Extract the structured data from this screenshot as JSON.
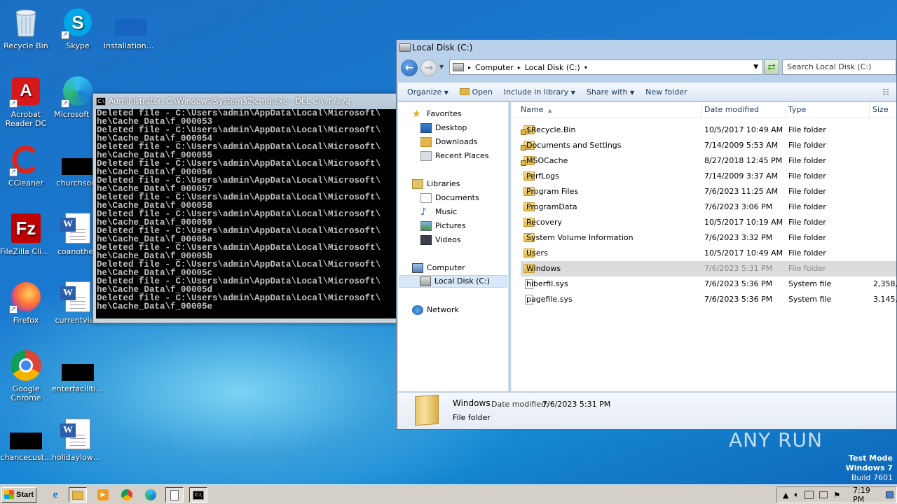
{
  "desktop": {
    "icons": [
      {
        "label": "Recycle Bin",
        "icon": "recycle-bin-icon"
      },
      {
        "label": "Skype",
        "icon": "skype-icon"
      },
      {
        "label": "installationfi...",
        "icon": "redacted-file-icon"
      },
      {
        "label": "Acrobat Reader DC",
        "icon": "acrobat-icon"
      },
      {
        "label": "Microsoft Ed",
        "icon": "edge-icon"
      },
      {
        "label": "CCleaner",
        "icon": "ccleaner-icon"
      },
      {
        "label": "churchsout",
        "icon": "redacted-file-icon"
      },
      {
        "label": "FileZilla Client",
        "icon": "filezilla-icon"
      },
      {
        "label": "coanother.",
        "icon": "word-doc-icon"
      },
      {
        "label": "Firefox",
        "icon": "firefox-icon"
      },
      {
        "label": "currentview",
        "icon": "word-doc-icon"
      },
      {
        "label": "Google Chrome",
        "icon": "chrome-icon"
      },
      {
        "label": "enterfacilitie...",
        "icon": "redacted-file-icon"
      },
      {
        "label": "chancecust...",
        "icon": "redacted-file-icon"
      },
      {
        "label": "holidaylowe...",
        "icon": "word-doc-icon"
      }
    ]
  },
  "cmd": {
    "title": "Administrator: C:\\Windows\\System32\\cmd.exe - DEL  C:\\ /f /s /q",
    "lines": [
      "Deleted file - C:\\Users\\admin\\AppData\\Local\\Microsoft\\",
      "he\\Cache_Data\\f_000053",
      "Deleted file - C:\\Users\\admin\\AppData\\Local\\Microsoft\\",
      "he\\Cache_Data\\f_000054",
      "Deleted file - C:\\Users\\admin\\AppData\\Local\\Microsoft\\",
      "he\\Cache_Data\\f_000055",
      "Deleted file - C:\\Users\\admin\\AppData\\Local\\Microsoft\\",
      "he\\Cache_Data\\f_000056",
      "Deleted file - C:\\Users\\admin\\AppData\\Local\\Microsoft\\",
      "he\\Cache_Data\\f_000057",
      "Deleted file - C:\\Users\\admin\\AppData\\Local\\Microsoft\\",
      "he\\Cache_Data\\f_000058",
      "Deleted file - C:\\Users\\admin\\AppData\\Local\\Microsoft\\",
      "he\\Cache_Data\\f_000059",
      "Deleted file - C:\\Users\\admin\\AppData\\Local\\Microsoft\\",
      "he\\Cache_Data\\f_00005a",
      "Deleted file - C:\\Users\\admin\\AppData\\Local\\Microsoft\\",
      "he\\Cache_Data\\f_00005b",
      "Deleted file - C:\\Users\\admin\\AppData\\Local\\Microsoft\\",
      "he\\Cache_Data\\f_00005c",
      "Deleted file - C:\\Users\\admin\\AppData\\Local\\Microsoft\\",
      "he\\Cache_Data\\f_00005d",
      "Deleted file - C:\\Users\\admin\\AppData\\Local\\Microsoft\\",
      "he\\Cache_Data\\f_00005e"
    ]
  },
  "explorer": {
    "title": "Local Disk (C:)",
    "breadcrumb": [
      "Computer",
      "Local Disk (C:)"
    ],
    "search_placeholder": "Search Local Disk (C:)",
    "toolbar": {
      "organize": "Organize",
      "open": "Open",
      "include": "Include in library",
      "share": "Share with",
      "new_folder": "New folder"
    },
    "nav": {
      "favorites": "Favorites",
      "desktop": "Desktop",
      "downloads": "Downloads",
      "recent": "Recent Places",
      "libraries": "Libraries",
      "documents": "Documents",
      "music": "Music",
      "pictures": "Pictures",
      "videos": "Videos",
      "computer": "Computer",
      "local_disk": "Local Disk (C:)",
      "network": "Network"
    },
    "columns": {
      "name": "Name",
      "date": "Date modified",
      "type": "Type",
      "size": "Size"
    },
    "files": [
      {
        "name": "$Recycle.Bin",
        "date": "10/5/2017 10:49 AM",
        "type": "File folder",
        "size": "",
        "kind": "locked-folder"
      },
      {
        "name": "Documents and Settings",
        "date": "7/14/2009 5:53 AM",
        "type": "File folder",
        "size": "",
        "kind": "locked-folder"
      },
      {
        "name": "MSOCache",
        "date": "8/27/2018 12:45 PM",
        "type": "File folder",
        "size": "",
        "kind": "locked-folder"
      },
      {
        "name": "PerfLogs",
        "date": "7/14/2009 3:37 AM",
        "type": "File folder",
        "size": "",
        "kind": "folder"
      },
      {
        "name": "Program Files",
        "date": "7/6/2023 11:25 AM",
        "type": "File folder",
        "size": "",
        "kind": "folder"
      },
      {
        "name": "ProgramData",
        "date": "7/6/2023 3:06 PM",
        "type": "File folder",
        "size": "",
        "kind": "folder"
      },
      {
        "name": "Recovery",
        "date": "10/5/2017 10:19 AM",
        "type": "File folder",
        "size": "",
        "kind": "folder"
      },
      {
        "name": "System Volume Information",
        "date": "7/6/2023 3:32 PM",
        "type": "File folder",
        "size": "",
        "kind": "folder"
      },
      {
        "name": "Users",
        "date": "10/5/2017 10:49 AM",
        "type": "File folder",
        "size": "",
        "kind": "folder"
      },
      {
        "name": "Windows",
        "date": "7/6/2023 5:31 PM",
        "type": "File folder",
        "size": "",
        "kind": "folder",
        "selected": true
      },
      {
        "name": "hiberfil.sys",
        "date": "7/6/2023 5:36 PM",
        "type": "System file",
        "size": "2,358,",
        "kind": "sysfile"
      },
      {
        "name": "pagefile.sys",
        "date": "7/6/2023 5:36 PM",
        "type": "System file",
        "size": "3,145,",
        "kind": "sysfile"
      }
    ],
    "details": {
      "name": "Windows",
      "date_label": "Date modified:",
      "date": "7/6/2023 5:31 PM",
      "type": "File folder"
    }
  },
  "watermark": {
    "text": "ANY RUN"
  },
  "testmode": {
    "line1": "Test Mode",
    "line2": "Windows 7",
    "line3": "Build 7601"
  },
  "taskbar": {
    "start": "Start",
    "clock": "7:19 PM"
  }
}
